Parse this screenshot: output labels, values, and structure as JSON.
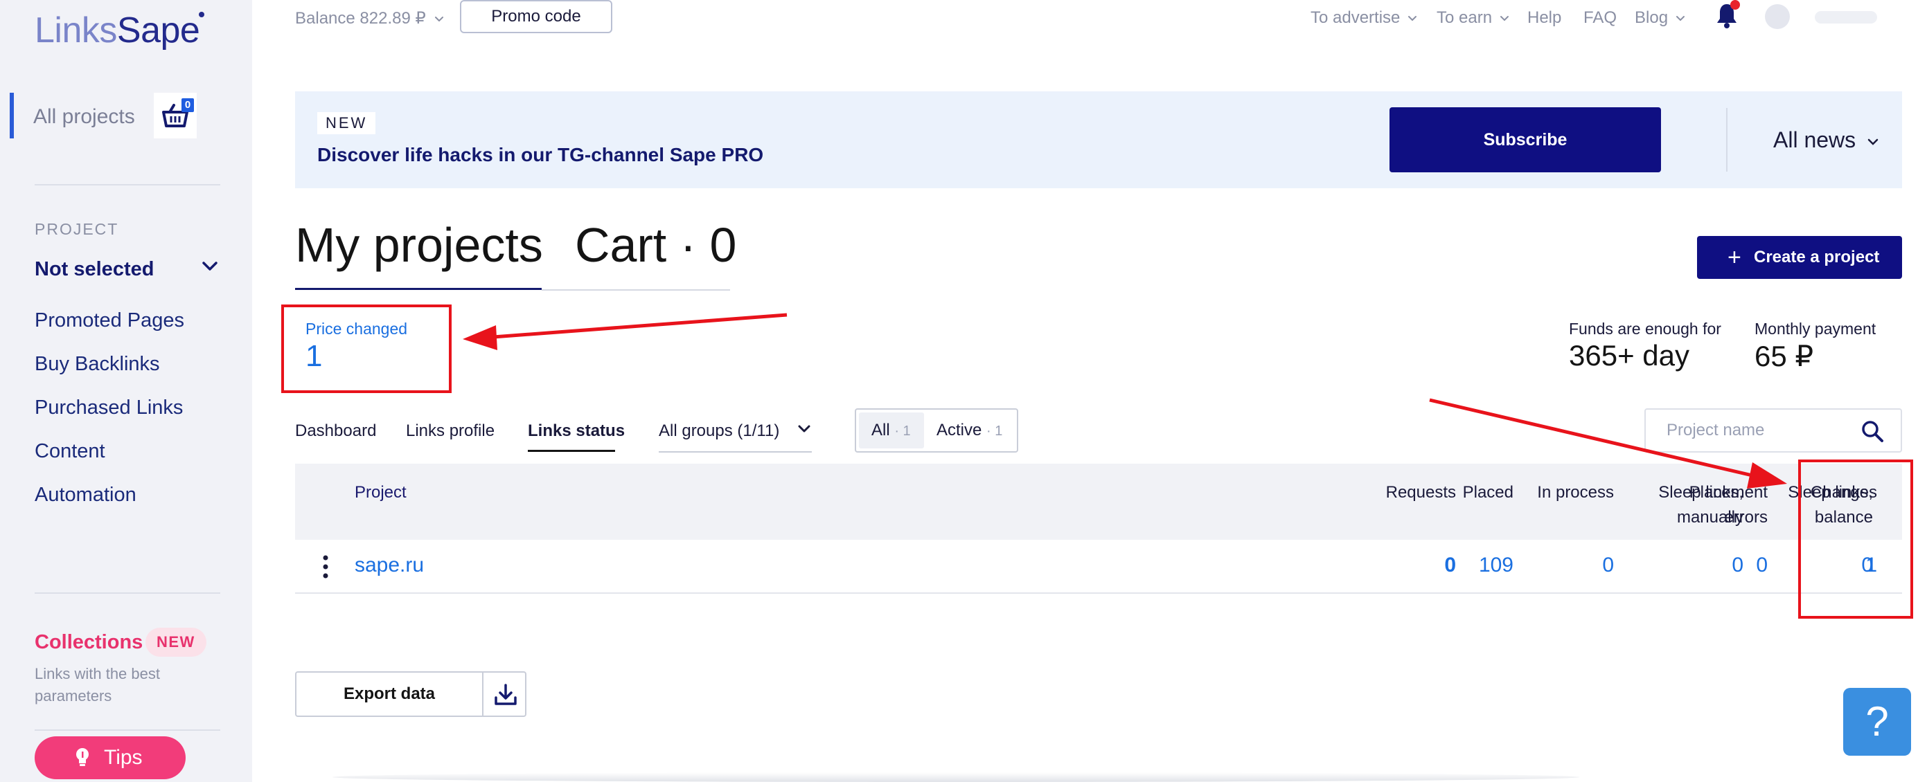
{
  "sidebar": {
    "logo_part1": "Links",
    "logo_part2": "Sape",
    "all_projects_label": "All projects",
    "all_projects_separator": "|",
    "cart_count": "0",
    "project_section_label": "PROJECT",
    "project_selected": "Not selected",
    "links": [
      {
        "label": "Promoted Pages"
      },
      {
        "label": "Buy Backlinks"
      },
      {
        "label": "Purchased Links"
      },
      {
        "label": "Content"
      },
      {
        "label": "Automation"
      }
    ],
    "collections_label": "Collections",
    "collections_badge": "NEW",
    "collections_desc": "Links with the best parameters",
    "tips_label": "Tips"
  },
  "header": {
    "balance": "Balance 822.89 ₽",
    "promo_label": "Promo code",
    "nav": [
      {
        "label": "To advertise",
        "dropdown": true
      },
      {
        "label": "To earn",
        "dropdown": true
      },
      {
        "label": "Help",
        "dropdown": false
      },
      {
        "label": "FAQ",
        "dropdown": false
      },
      {
        "label": "Blog",
        "dropdown": true
      }
    ]
  },
  "banner": {
    "tag": "NEW",
    "text": "Discover life hacks in our TG-channel Sape PRO",
    "subscribe_label": "Subscribe",
    "all_news_label": "All news"
  },
  "page": {
    "title": "My projects",
    "cart_title": "Cart · 0",
    "create_label": "Create a project",
    "price_changed_label": "Price changed",
    "price_changed_value": "1",
    "funds_label": "Funds are enough for",
    "funds_value": "365+ day",
    "monthly_label": "Monthly payment",
    "monthly_value": "65 ₽"
  },
  "tabs": [
    {
      "label": "Dashboard",
      "active": false
    },
    {
      "label": "Links profile",
      "active": false
    },
    {
      "label": "Links status",
      "active": true
    }
  ],
  "filters": {
    "groups_label": "All groups (1/11)",
    "all_label": "All",
    "all_count": "· 1",
    "active_label": "Active",
    "active_count": "· 1"
  },
  "search": {
    "placeholder": "Project name"
  },
  "table": {
    "project_header": "Project",
    "columns": [
      {
        "key": "requests",
        "line1": "Requests",
        "line2": ""
      },
      {
        "key": "placed",
        "line1": "Placed",
        "line2": ""
      },
      {
        "key": "in_process",
        "line1": "In process",
        "line2": ""
      },
      {
        "key": "sleep_manual",
        "line1": "Sleep links,",
        "line2": "manually"
      },
      {
        "key": "sleep_balance",
        "line1": "Sleep links,",
        "line2": "balance"
      },
      {
        "key": "placement_errors",
        "line1": "Placement",
        "line2": "errors"
      },
      {
        "key": "changes",
        "line1": "Changes",
        "line2": ""
      }
    ],
    "rows": [
      {
        "project": "sape.ru",
        "requests": "0",
        "placed": "109",
        "in_process": "0",
        "sleep_manual": "0",
        "sleep_balance": "0",
        "placement_errors": "0",
        "changes": "1"
      }
    ]
  },
  "export": {
    "label": "Export data"
  },
  "help": {
    "label": "?"
  },
  "colors": {
    "navy": "#0f0f82",
    "link_blue": "#1a6fe0",
    "accent_pink": "#f23c7a",
    "annotation_red": "#e8131b",
    "banner_bg": "#ebf2fc",
    "sidebar_bg": "#f1f2f7"
  }
}
